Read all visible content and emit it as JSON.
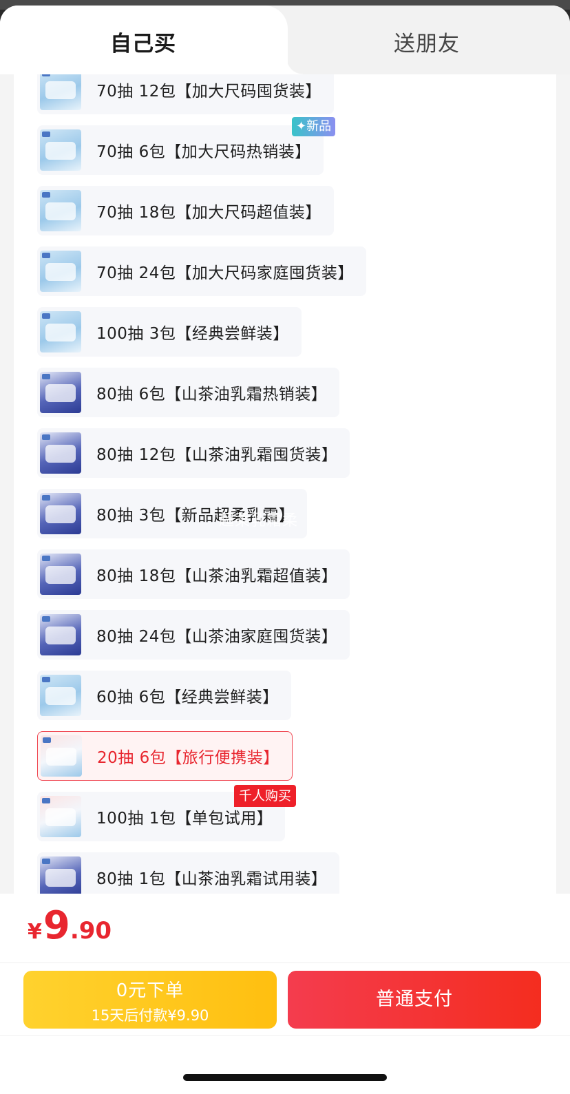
{
  "tabs": {
    "self_buy": "自己买",
    "gift_friend": "送朋友"
  },
  "badges": {
    "new": "✦新品",
    "hot": "千人购买"
  },
  "watermark": "超柔乳霜柔",
  "skus": [
    {
      "label": "70抽 12包【加大尺码囤货装】",
      "thumb": "light"
    },
    {
      "label": "70抽 6包【加大尺码热销装】",
      "thumb": "light"
    },
    {
      "label": "70抽 18包【加大尺码超值装】",
      "thumb": "light"
    },
    {
      "label": "70抽 24包【加大尺码家庭囤货装】",
      "thumb": "light"
    },
    {
      "label": "100抽 3包【经典尝鲜装】",
      "thumb": "light"
    },
    {
      "label": "80抽 6包【山茶油乳霜热销装】",
      "thumb": "dark"
    },
    {
      "label": "80抽 12包【山茶油乳霜囤货装】",
      "thumb": "dark"
    },
    {
      "label": "80抽 3包【新品超柔乳霜】",
      "thumb": "dark"
    },
    {
      "label": "80抽 18包【山茶油乳霜超值装】",
      "thumb": "dark"
    },
    {
      "label": "80抽 24包【山茶油家庭囤货装】",
      "thumb": "dark"
    },
    {
      "label": "60抽 6包【经典尝鲜装】",
      "thumb": "light"
    },
    {
      "label": "20抽 6包【旅行便携装】",
      "thumb": "red",
      "selected": true
    },
    {
      "label": "100抽 1包【单包试用】",
      "thumb": "red"
    },
    {
      "label": "80抽 1包【山茶油乳霜试用装】",
      "thumb": "dark"
    }
  ],
  "price": {
    "currency": "¥",
    "integer": "9",
    "decimal": ".90"
  },
  "buttons": {
    "pay_later_title": "0元下单",
    "pay_later_sub": "15天后付款¥9.90",
    "pay_now": "普通支付"
  },
  "colors": {
    "accent_red": "#e8262f",
    "yellow": "#ffc81e"
  }
}
